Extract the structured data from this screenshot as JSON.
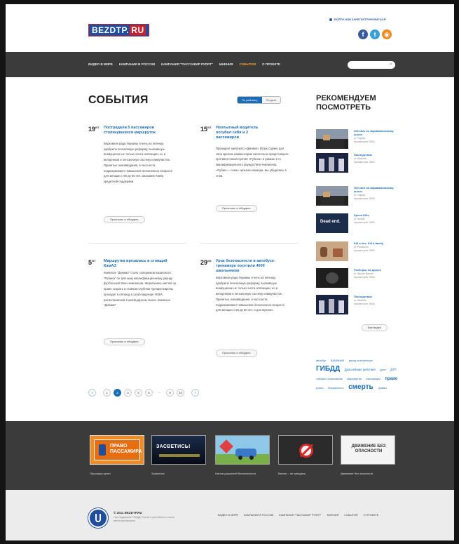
{
  "header": {
    "logo_main": "BEZDTP",
    "logo_ru": "RU",
    "login": "ВОЙТИ ИЛИ ЗАРЕГИСТРИРОВАТЬСЯ",
    "social": [
      "f",
      "t",
      "rss"
    ]
  },
  "nav": {
    "items": [
      "ВИДЕО В МИРЕ",
      "КАМПАНИИ В РОССИИ",
      "КАМПАНИЯ \"ПАССАЖИР РУЛИТ\"",
      "МНЕНИЯ",
      "СОБЫТИЯ",
      "О ПРОЕКТЕ"
    ],
    "active_index": 4,
    "search_placeholder": ""
  },
  "main": {
    "title": "СОБЫТИЯ",
    "sort": [
      "По рейтингу",
      "По дате"
    ],
    "more_label": "Прочитать и обсудить",
    "articles": [
      {
        "day": "19",
        "month": "/07",
        "headline": "Пострадали 5 пассажиров столкнувшихся маршруток",
        "body": "Верховная рада Украины в ночь на пятницу одобрила пенсионную реформу, вызвавшую возмущение не только части оппозиции, но и вкладчиков в пенсионную систему коммунистов. Принятые нововведения, в частности, подразумевают повышение пенсионного возраста для женщин с 55 до 60 лет. Оказание Киеву кредитной поддержки."
      },
      {
        "day": "15",
        "month": "/07",
        "headline": "Неопытный водитель погубил себя и 3 пассажиров",
        "body": "Президент киевского «Динамо» Игорь Суркис дал свои краткие комментарии касательно предстоящего противостояния против «Рубина» в рамках 3-го квалификационного раунда Лиги чемпионов. «Рубин» – очень сильная команда, мы убедились в этом."
      },
      {
        "day": "5",
        "month": "/07",
        "headline": "Маршрутка врезалась в стоящий КамАЗ",
        "body": "Киевское \"Динамо\" стало соперником казанского \"Рубина\" по третьему квалификационному раунду футбольной Лиги чемпионов. Жеребьевка матчей за право сыграть в главном клубном турнире Европы проходит в пятницу в штаб-квартире УЕФА, расположенной в швейцарском Ньоне. Киевское \"Динамо\""
      },
      {
        "day": "29",
        "month": "/06",
        "headline": "Урок безопасности в автобусе-тренажере посетили 4000 школьников",
        "body": "Верховная рада Украины в ночь на пятницу одобрила пенсионную реформу, вызвавшую возмущение не только части оппозиции, но и вкладчиков в пенсионную систему коммунистов. Принятые нововведения, в частности, подразумевают повышение пенсионного возраста для женщин с 55 до 60 лет, а для мужчин."
      }
    ],
    "pager": [
      "‹",
      "1",
      "2",
      "3",
      "4",
      "5",
      "...",
      "9",
      "10",
      "›"
    ],
    "pager_current": "2"
  },
  "sidebar": {
    "title_line1": "РЕКОМЕНДУЕМ",
    "title_line2": "ПОСМОТРЕТЬ",
    "items": [
      {
        "title": "200 км/ч по мараванинскому шоссе",
        "author": "от Yaposk",
        "meta": "просмотров: 3500",
        "thumb": "road"
      },
      {
        "title": "Последствие",
        "author": "от Hadekle",
        "meta": "просмотров: 3500",
        "thumb": "crowd"
      },
      {
        "title": "200 км/ч по мараванинскому шоссе",
        "author": "от Yaposk",
        "meta": "просмотров: 3500",
        "thumb": "road"
      },
      {
        "title": "Speed Kills",
        "author": "от Gluslio",
        "meta": "просмотров: 3500",
        "thumb": "dead"
      },
      {
        "title": "Kill a line, Kill a family",
        "author": "от Pocksinks",
        "meta": "просмотров: 3500",
        "thumb": "family"
      },
      {
        "title": "Разборки на дороге",
        "author": "от Hanuin Barnel",
        "meta": "просмотров: 3500",
        "thumb": "dark"
      },
      {
        "title": "Последствие",
        "author": "от Hadekle",
        "meta": "просмотров: 3500",
        "thumb": "crowd"
      }
    ],
    "all_video": "Все видео",
    "tags": [
      {
        "t": "автобус",
        "s": 4
      },
      {
        "t": "ВЛИЯНИЕ",
        "s": 4
      },
      {
        "t": "выход на встречную",
        "s": 3.6
      },
      {
        "t": "ГИБДД",
        "s": 10
      },
      {
        "t": "Дальнейшие действия",
        "s": 4.2
      },
      {
        "t": "дети",
        "s": 4
      },
      {
        "t": "ДТП",
        "s": 4.2
      },
      {
        "t": "лобовое столкновение",
        "s": 3.6
      },
      {
        "t": "маршрутка",
        "s": 4
      },
      {
        "t": "пассажиры",
        "s": 4
      },
      {
        "t": "право",
        "s": 6
      },
      {
        "t": "ремни",
        "s": 3.6
      },
      {
        "t": "безопасности",
        "s": 3.6
      },
      {
        "t": "смерть",
        "s": 10
      },
      {
        "t": "травмы",
        "s": 3.6
      }
    ]
  },
  "promo": {
    "cards": [
      {
        "caption": "Пассажир рулит",
        "label": "ПРАВО ПАССАЖИРА",
        "style": "orange"
      },
      {
        "caption": "Засветись",
        "label": "ЗАСВЕТИСЬ!",
        "style": "night"
      },
      {
        "caption": "Школа дорожной безопасности",
        "label": "",
        "style": "cartoon"
      },
      {
        "caption": "Выпил – не заводись",
        "label": "",
        "style": "dark"
      },
      {
        "caption": "Движение без опасности",
        "label": "ДВИЖЕНИЕ БЕЗ ОПАСНОСТИ",
        "style": "light"
      }
    ]
  },
  "footer": {
    "copyright": "© 2011 BEZDTP.RU",
    "text": "При поддержке ГИБДД России и российского союза автостраховщиков",
    "links": [
      "ВИДЕО В МИРЕ",
      "КАМПАНИИ В РОССИИ",
      "КАМПАНИЯ \"ПАССАЖИР РУЛИТ\"",
      "МНЕНИЯ",
      "СОБЫТИЯ",
      "О ПРОЕКТЕ"
    ]
  }
}
